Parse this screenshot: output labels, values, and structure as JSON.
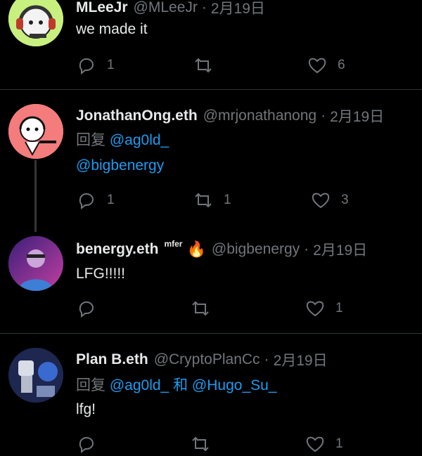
{
  "tweets": [
    {
      "name": "MLeeJr",
      "handle": "@MLeeJr",
      "dot": "·",
      "date": "2月19日",
      "text": "we made it",
      "reply_count": "1",
      "retweet_count": "",
      "like_count": "6"
    },
    {
      "name": "JonathanOng.eth",
      "handle": "@mrjonathanong",
      "dot": "·",
      "date": "2月19日",
      "reply_prefix": "回复",
      "mention1": "@ag0ld_",
      "mention2": "@bigbenergy",
      "reply_count": "1",
      "retweet_count": "1",
      "like_count": "3"
    },
    {
      "name": "benergy.eth",
      "badge": "mfer",
      "emoji": "🔥",
      "handle": "@bigbenergy",
      "dot": "·",
      "date": "2月19日",
      "text": "LFG!!!!!",
      "reply_count": "",
      "retweet_count": "",
      "like_count": "1"
    },
    {
      "name": "Plan B.eth",
      "handle": "@CryptoPlanCc",
      "dot": "·",
      "date": "2月19日",
      "reply_prefix": "回复",
      "mention1": "@ag0ld_",
      "and_word": "和",
      "mention2": "@Hugo_Su_",
      "text": "lfg!",
      "reply_count": "",
      "retweet_count": "",
      "like_count": "1"
    }
  ],
  "colors": {
    "background": "#000000",
    "text": "#e7e9ea",
    "muted": "#71767b",
    "link": "#1d9bf0",
    "divider": "#2f3336"
  },
  "icons": {
    "reply": "reply-icon",
    "retweet": "retweet-icon",
    "like": "heart-icon"
  }
}
